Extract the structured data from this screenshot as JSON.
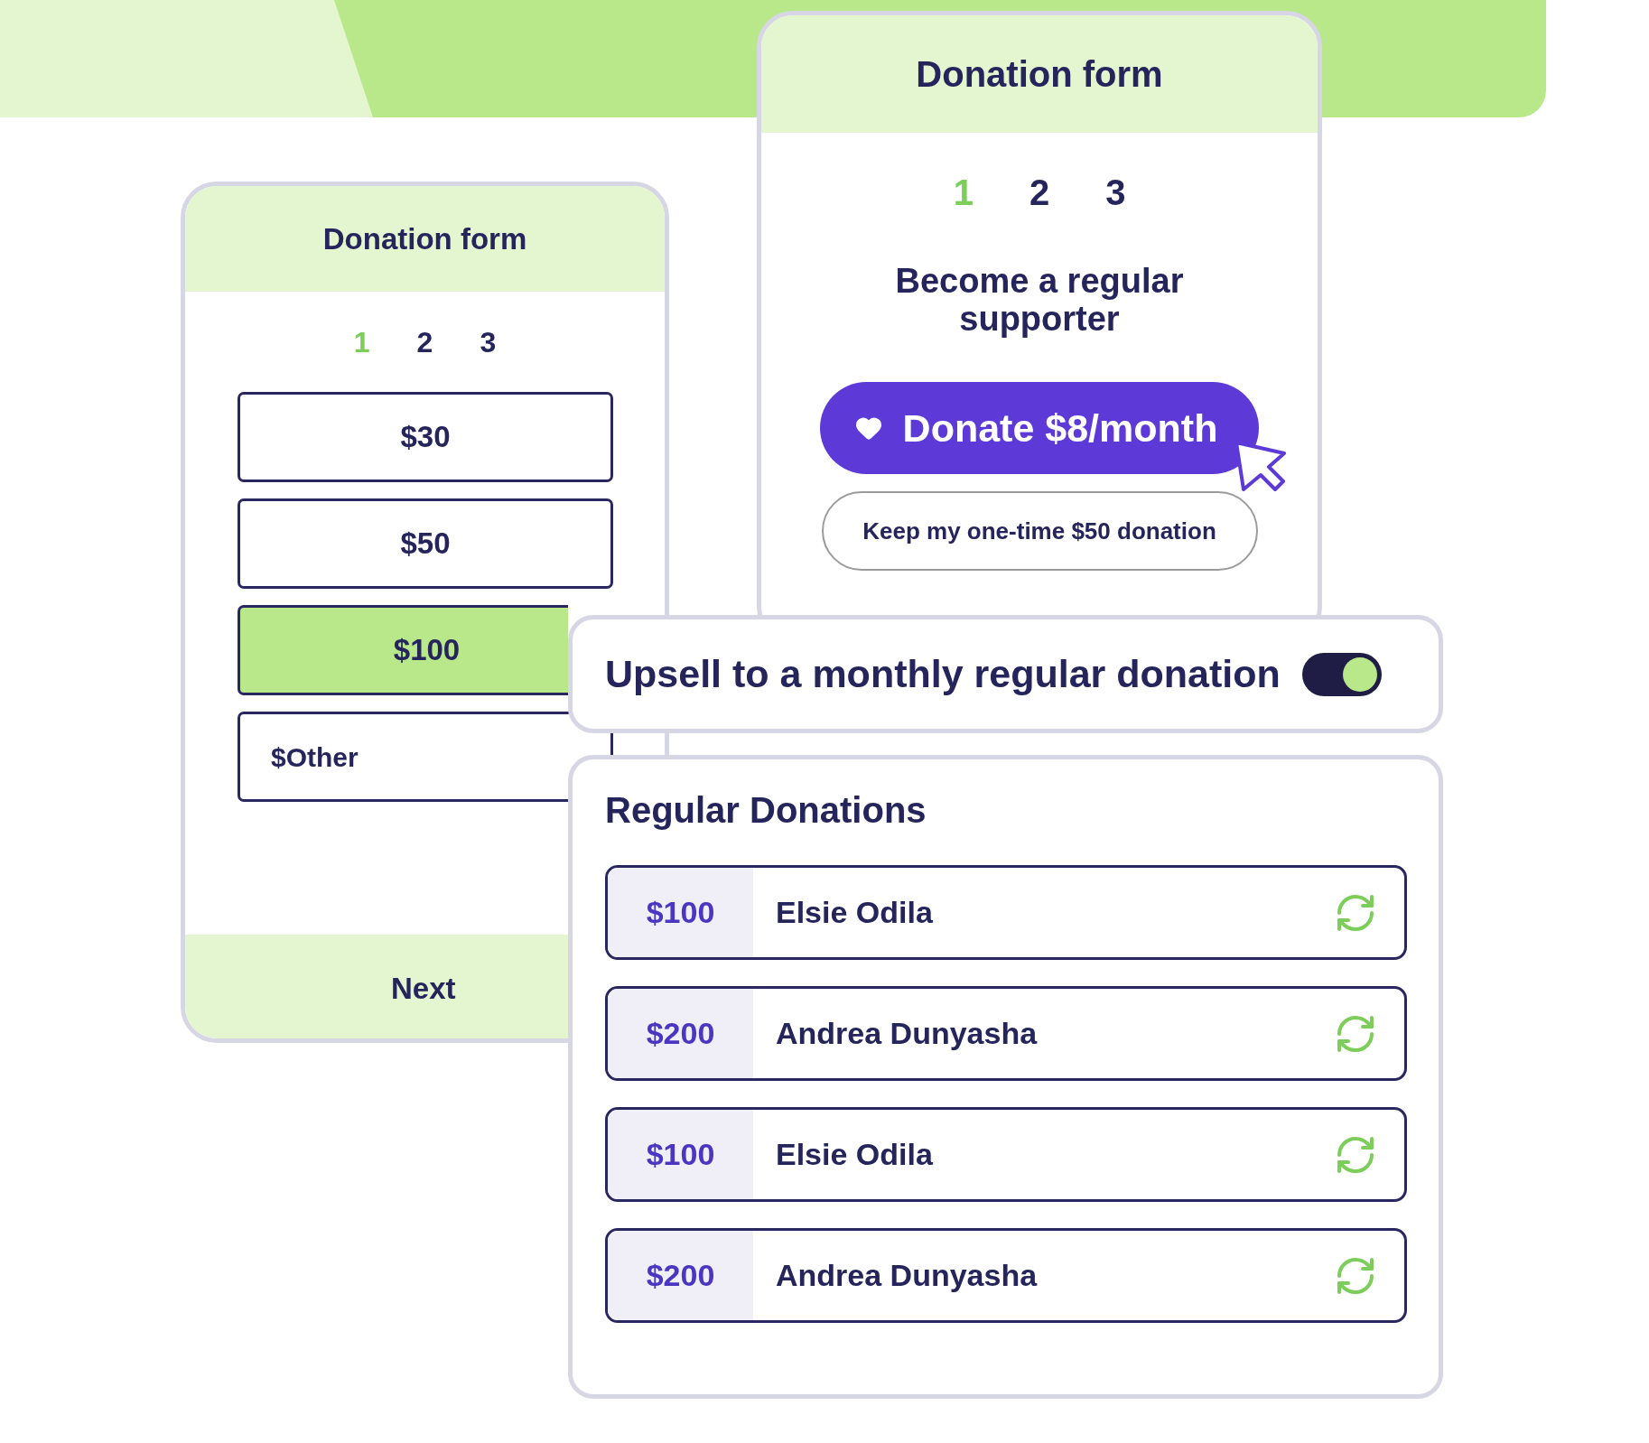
{
  "amount_form": {
    "title": "Donation form",
    "steps": [
      {
        "label": "1",
        "selected": true
      },
      {
        "label": "2",
        "selected": false
      },
      {
        "label": "3",
        "selected": false
      }
    ],
    "amounts": [
      {
        "kind": "option",
        "label": "$30",
        "selected": false
      },
      {
        "kind": "option",
        "label": "$50",
        "selected": false
      },
      {
        "kind": "option",
        "label": "$100",
        "selected": true
      },
      {
        "kind": "custom",
        "label": "$Other",
        "selected": false
      }
    ],
    "next_button": "Next"
  },
  "supporter_form": {
    "title": "Donation form",
    "steps": [
      {
        "label": "1",
        "selected": true
      },
      {
        "label": "2",
        "selected": false
      },
      {
        "label": "3",
        "selected": false
      }
    ],
    "heading": "Become a regular supporter",
    "donate_button": "Donate $8/month",
    "keep_button": "Keep my one-time $50 donation"
  },
  "upsell": {
    "label": "Upsell to a monthly regular donation",
    "on": true
  },
  "regular_donations": {
    "title": "Regular Donations",
    "rows": [
      {
        "amount": "$100",
        "name": "Elsie Odila"
      },
      {
        "amount": "$200",
        "name": "Andrea Dunyasha"
      },
      {
        "amount": "$100",
        "name": "Elsie Odila"
      },
      {
        "amount": "$200",
        "name": "Andrea Dunyasha"
      }
    ]
  }
}
